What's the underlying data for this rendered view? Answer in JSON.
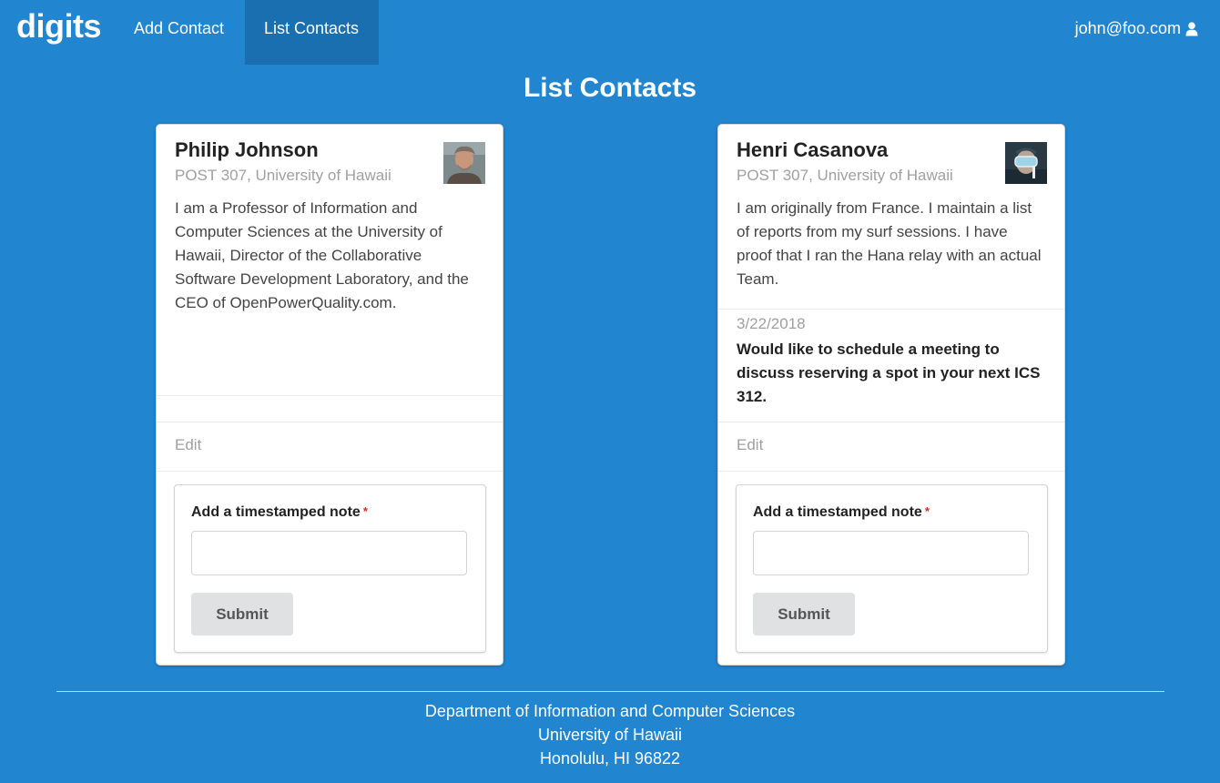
{
  "nav": {
    "brand": "digits",
    "items": [
      {
        "label": "Add Contact"
      },
      {
        "label": "List Contacts"
      }
    ],
    "user": "john@foo.com"
  },
  "page": {
    "title": "List Contacts"
  },
  "contacts": [
    {
      "name": "Philip Johnson",
      "address": "POST 307, University of Hawaii",
      "description": "I am a Professor of Information and Computer Sciences at the University of Hawaii, Director of the Collaborative Software Development Laboratory, and the CEO of OpenPowerQuality.com.",
      "edit_label": "Edit",
      "form": {
        "label": "Add a timestamped note",
        "required_mark": "*",
        "input_value": "",
        "submit_label": "Submit"
      }
    },
    {
      "name": "Henri Casanova",
      "address": "POST 307, University of Hawaii",
      "description": "I am originally from France. I maintain a list of reports from my surf sessions. I have proof that I ran the Hana relay with an actual Team.",
      "note": {
        "date": "3/22/2018",
        "text": "Would like to schedule a meeting to discuss reserving a spot in your next ICS 312."
      },
      "edit_label": "Edit",
      "form": {
        "label": "Add a timestamped note",
        "required_mark": "*",
        "input_value": "",
        "submit_label": "Submit"
      }
    }
  ],
  "footer": {
    "line1": "Department of Information and Computer Sciences",
    "line2": "University of Hawaii",
    "line3": "Honolulu, HI 96822"
  }
}
